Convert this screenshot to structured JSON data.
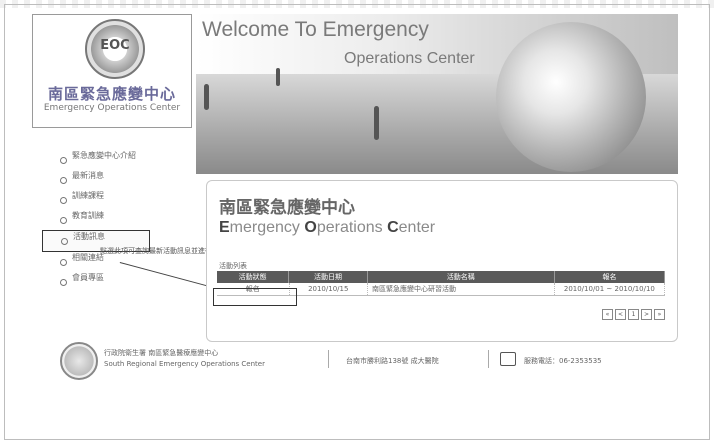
{
  "logo": {
    "emblem_text": "EOC",
    "title": "南區緊急應變中心",
    "subtitle": "Emergency Operations Center"
  },
  "banner": {
    "line1": "Welcome To Emergency",
    "line2": "Operations Center"
  },
  "nav": {
    "items": [
      {
        "label": "緊急應變中心介紹"
      },
      {
        "label": "最新消息"
      },
      {
        "label": "訓練課程"
      },
      {
        "label": "教育訓練"
      },
      {
        "label": "活動訊息"
      },
      {
        "label": "相關連結"
      },
      {
        "label": "會員專區"
      }
    ],
    "callout": "點選此項可查詢最新活動訊息並進行線上報名"
  },
  "panel": {
    "title": "南區緊急應變中心",
    "subtitle_pre": "E",
    "subtitle_mid": "mergency ",
    "subtitle_o": "O",
    "subtitle_mid2": "perations ",
    "subtitle_c": "C",
    "subtitle_end": "enter",
    "table_caption": "活動列表",
    "columns": [
      "活動狀態",
      "活動日期",
      "活動名稱",
      "報名"
    ],
    "rows": [
      [
        "報名",
        "2010/10/15",
        "南區緊急應變中心研習活動",
        "2010/10/01 ~ 2010/10/10"
      ]
    ],
    "pager": [
      "«",
      "<",
      "1",
      ">",
      "»"
    ]
  },
  "footer": {
    "org_line1": "行政院衛生署 南區緊急醫療應變中心",
    "org_line2": "South Regional Emergency Operations Center",
    "mid": "台南市勝利路138號 成大醫院",
    "right": "服務電話：06-2353535"
  }
}
